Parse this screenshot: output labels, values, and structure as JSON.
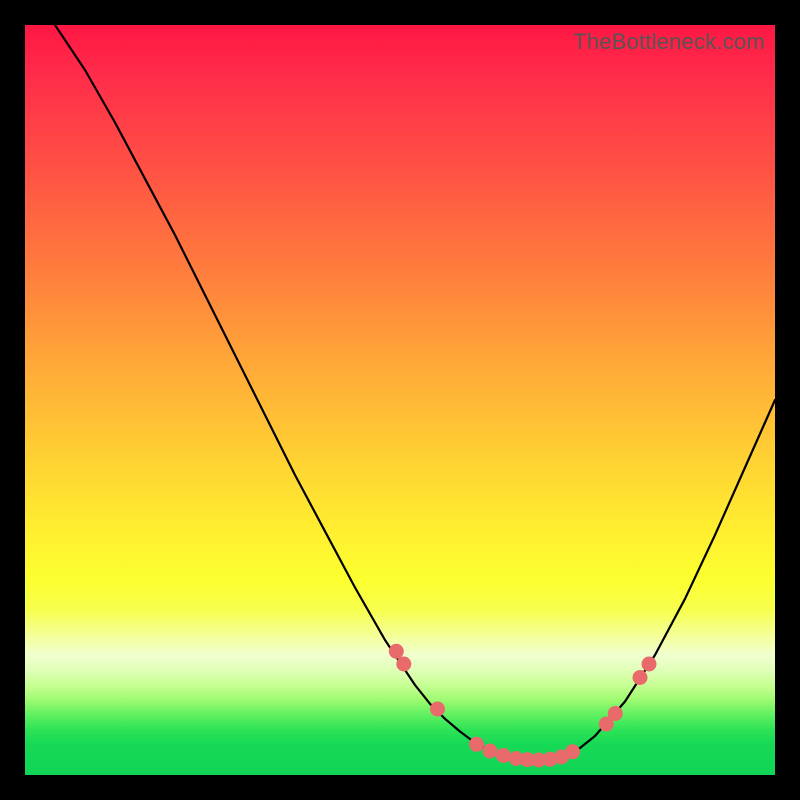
{
  "watermark": "TheBottleneck.com",
  "colors": {
    "frame": "#000000",
    "curve": "#000000",
    "dot": "#e96a6a",
    "gradient_top": "#ff1744",
    "gradient_bottom": "#11d456"
  },
  "chart_data": {
    "type": "line",
    "title": "",
    "xlabel": "",
    "ylabel": "",
    "xlim": [
      0,
      100
    ],
    "ylim": [
      0,
      100
    ],
    "series": [
      {
        "name": "bottleneck-curve",
        "x": [
          4,
          8,
          12,
          16,
          20,
          24,
          28,
          32,
          36,
          40,
          44,
          48,
          52,
          54,
          56,
          58,
          60,
          62,
          64,
          66,
          68,
          70,
          72,
          74,
          76,
          80,
          84,
          88,
          92,
          96,
          100
        ],
        "y": [
          100,
          94,
          87,
          79.5,
          72,
          64,
          56,
          48,
          40,
          32.5,
          25,
          18,
          12,
          9.5,
          7.5,
          5.8,
          4.3,
          3.2,
          2.5,
          2.1,
          2.0,
          2.1,
          2.6,
          3.6,
          5.2,
          9.8,
          16,
          23.5,
          32,
          41,
          50
        ]
      }
    ],
    "markers": [
      {
        "x": 49.5,
        "y": 16.5
      },
      {
        "x": 50.5,
        "y": 14.8
      },
      {
        "x": 55.0,
        "y": 8.8
      },
      {
        "x": 60.2,
        "y": 4.1
      },
      {
        "x": 62.0,
        "y": 3.2
      },
      {
        "x": 63.8,
        "y": 2.6
      },
      {
        "x": 65.5,
        "y": 2.2
      },
      {
        "x": 67.0,
        "y": 2.05
      },
      {
        "x": 68.5,
        "y": 2.0
      },
      {
        "x": 70.0,
        "y": 2.1
      },
      {
        "x": 71.5,
        "y": 2.4
      },
      {
        "x": 73.0,
        "y": 3.1
      },
      {
        "x": 77.5,
        "y": 6.8
      },
      {
        "x": 78.7,
        "y": 8.2
      },
      {
        "x": 82.0,
        "y": 13.0
      },
      {
        "x": 83.2,
        "y": 14.8
      }
    ],
    "notes": "Axes carry no tick labels or axis titles in the source image; gradient background encodes severity from red (high) to green (low). Values are read off the image in percent of plot width/height."
  }
}
